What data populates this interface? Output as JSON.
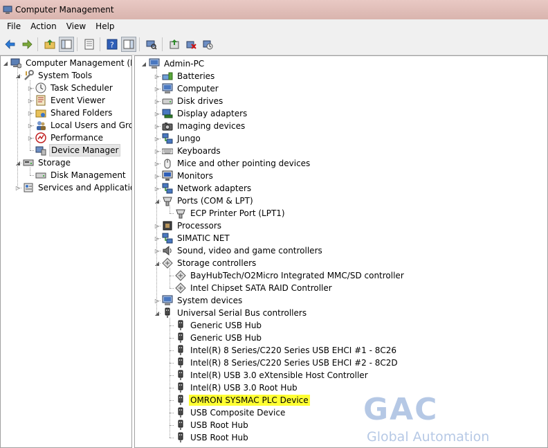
{
  "window": {
    "title": "Computer Management"
  },
  "menu": [
    "File",
    "Action",
    "View",
    "Help"
  ],
  "toolbar": {
    "buttons": [
      "back-icon",
      "forward-icon",
      "up-folder-icon",
      "show-hide-tree-icon",
      "properties-icon",
      "help-icon",
      "show-action-pane-icon",
      "scan-hardware-icon",
      "update-driver-icon",
      "uninstall-icon",
      "disable-device-icon"
    ]
  },
  "left_tree": [
    {
      "label": "Computer Management (Local",
      "icon": "computer-management-icon",
      "depth": 0,
      "expander": "expanded"
    },
    {
      "label": "System Tools",
      "icon": "system-tools-icon",
      "depth": 1,
      "expander": "expanded"
    },
    {
      "label": "Task Scheduler",
      "icon": "clock-icon",
      "depth": 2,
      "expander": "collapsed"
    },
    {
      "label": "Event Viewer",
      "icon": "event-viewer-icon",
      "depth": 2,
      "expander": "collapsed"
    },
    {
      "label": "Shared Folders",
      "icon": "shared-folder-icon",
      "depth": 2,
      "expander": "collapsed"
    },
    {
      "label": "Local Users and Groups",
      "icon": "users-icon",
      "depth": 2,
      "expander": "collapsed"
    },
    {
      "label": "Performance",
      "icon": "performance-icon",
      "depth": 2,
      "expander": "collapsed"
    },
    {
      "label": "Device Manager",
      "icon": "device-manager-icon",
      "depth": 2,
      "expander": "none",
      "selected": true
    },
    {
      "label": "Storage",
      "icon": "storage-icon",
      "depth": 1,
      "expander": "expanded"
    },
    {
      "label": "Disk Management",
      "icon": "disk-management-icon",
      "depth": 2,
      "expander": "none"
    },
    {
      "label": "Services and Applications",
      "icon": "services-icon",
      "depth": 1,
      "expander": "collapsed"
    }
  ],
  "right_tree": [
    {
      "label": "Admin-PC",
      "icon": "computer-icon",
      "depth": 0,
      "expander": "expanded"
    },
    {
      "label": "Batteries",
      "icon": "battery-icon",
      "depth": 1,
      "expander": "collapsed"
    },
    {
      "label": "Computer",
      "icon": "computer-icon",
      "depth": 1,
      "expander": "collapsed"
    },
    {
      "label": "Disk drives",
      "icon": "disk-drive-icon",
      "depth": 1,
      "expander": "collapsed"
    },
    {
      "label": "Display adapters",
      "icon": "display-adapter-icon",
      "depth": 1,
      "expander": "collapsed"
    },
    {
      "label": "Imaging devices",
      "icon": "camera-icon",
      "depth": 1,
      "expander": "collapsed"
    },
    {
      "label": "Jungo",
      "icon": "network-icon",
      "depth": 1,
      "expander": "collapsed"
    },
    {
      "label": "Keyboards",
      "icon": "keyboard-icon",
      "depth": 1,
      "expander": "collapsed"
    },
    {
      "label": "Mice and other pointing devices",
      "icon": "mouse-icon",
      "depth": 1,
      "expander": "collapsed"
    },
    {
      "label": "Monitors",
      "icon": "monitor-icon",
      "depth": 1,
      "expander": "collapsed"
    },
    {
      "label": "Network adapters",
      "icon": "network-icon",
      "depth": 1,
      "expander": "collapsed"
    },
    {
      "label": "Ports (COM & LPT)",
      "icon": "port-icon",
      "depth": 1,
      "expander": "expanded"
    },
    {
      "label": "ECP Printer Port (LPT1)",
      "icon": "port-icon",
      "depth": 2,
      "expander": "none"
    },
    {
      "label": "Processors",
      "icon": "processor-icon",
      "depth": 1,
      "expander": "collapsed"
    },
    {
      "label": "SIMATIC NET",
      "icon": "network-icon",
      "depth": 1,
      "expander": "collapsed"
    },
    {
      "label": "Sound, video and game controllers",
      "icon": "speaker-icon",
      "depth": 1,
      "expander": "collapsed"
    },
    {
      "label": "Storage controllers",
      "icon": "storage-controller-icon",
      "depth": 1,
      "expander": "expanded"
    },
    {
      "label": "BayHubTech/O2Micro Integrated MMC/SD controller",
      "icon": "storage-controller-icon",
      "depth": 2,
      "expander": "none"
    },
    {
      "label": "Intel Chipset SATA RAID Controller",
      "icon": "storage-controller-icon",
      "depth": 2,
      "expander": "none"
    },
    {
      "label": "System devices",
      "icon": "system-device-icon",
      "depth": 1,
      "expander": "collapsed"
    },
    {
      "label": "Universal Serial Bus controllers",
      "icon": "usb-icon",
      "depth": 1,
      "expander": "expanded"
    },
    {
      "label": "Generic USB Hub",
      "icon": "usb-icon",
      "depth": 2,
      "expander": "none"
    },
    {
      "label": "Generic USB Hub",
      "icon": "usb-icon",
      "depth": 2,
      "expander": "none"
    },
    {
      "label": "Intel(R) 8 Series/C220 Series USB EHCI #1 - 8C26",
      "icon": "usb-icon",
      "depth": 2,
      "expander": "none"
    },
    {
      "label": "Intel(R) 8 Series/C220 Series USB EHCI #2 - 8C2D",
      "icon": "usb-icon",
      "depth": 2,
      "expander": "none"
    },
    {
      "label": "Intel(R) USB 3.0 eXtensible Host Controller",
      "icon": "usb-icon",
      "depth": 2,
      "expander": "none"
    },
    {
      "label": "Intel(R) USB 3.0 Root Hub",
      "icon": "usb-icon",
      "depth": 2,
      "expander": "none"
    },
    {
      "label": "OMRON SYSMAC PLC Device",
      "icon": "usb-icon",
      "depth": 2,
      "expander": "none",
      "highlighted": true
    },
    {
      "label": "USB Composite Device",
      "icon": "usb-icon",
      "depth": 2,
      "expander": "none"
    },
    {
      "label": "USB Root Hub",
      "icon": "usb-icon",
      "depth": 2,
      "expander": "none"
    },
    {
      "label": "USB Root Hub",
      "icon": "usb-icon",
      "depth": 2,
      "expander": "none"
    }
  ],
  "watermark": {
    "big": "GAC",
    "small": "Global Automation"
  }
}
